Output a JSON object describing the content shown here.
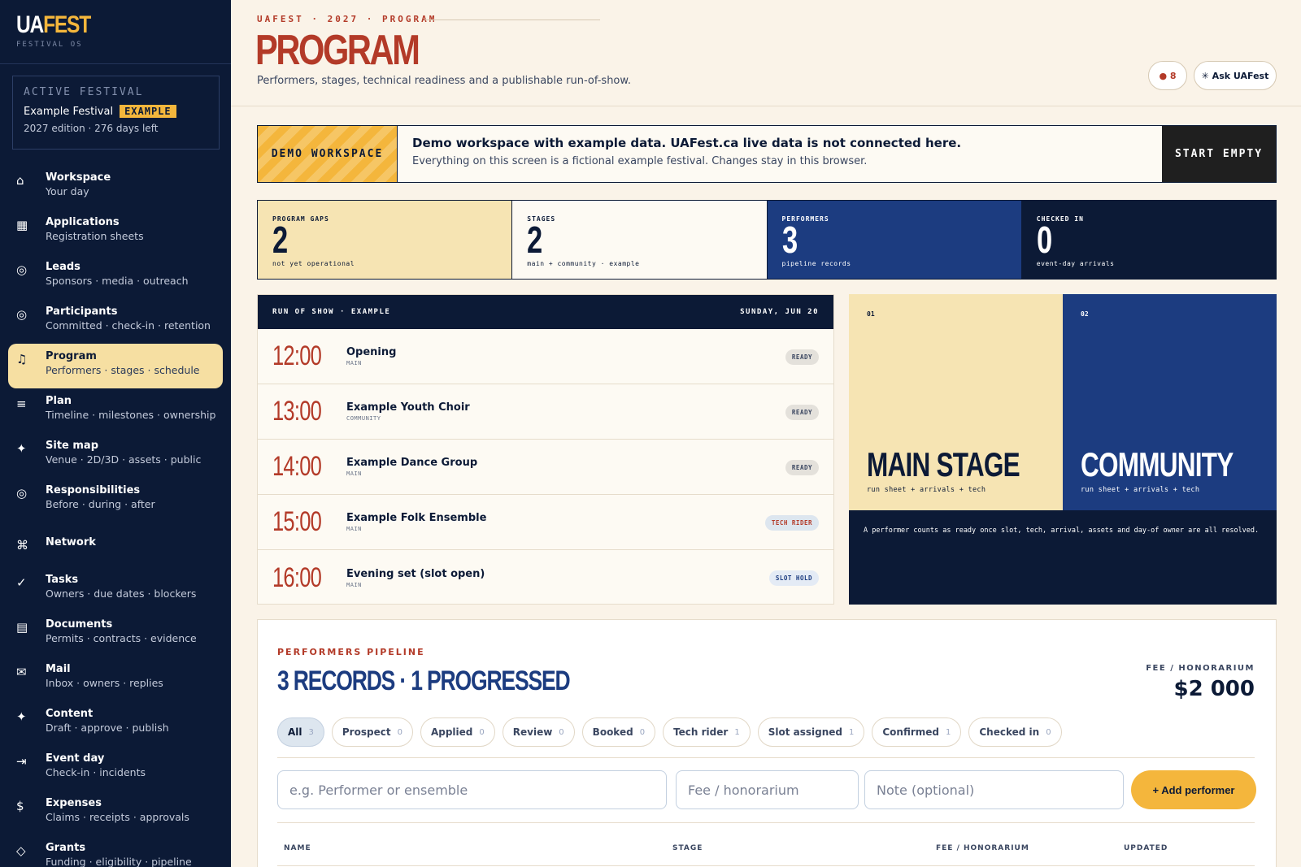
{
  "brand": {
    "logo_a": "UA",
    "logo_b": "FEST",
    "sub": "FESTIVAL OS"
  },
  "active_festival": {
    "label": "ACTIVE FESTIVAL",
    "name": "Example Festival",
    "badge": "EXAMPLE",
    "meta": "2027 edition · 276 days left"
  },
  "nav": [
    {
      "icon": "⌂",
      "title": "Workspace",
      "sub": "Your day"
    },
    {
      "icon": "▦",
      "title": "Applications",
      "sub": "Registration sheets"
    },
    {
      "icon": "◎",
      "title": "Leads",
      "sub": "Sponsors · media · outreach"
    },
    {
      "icon": "◎",
      "title": "Participants",
      "sub": "Committed · check-in · retention"
    },
    {
      "icon": "♫",
      "title": "Program",
      "sub": "Performers · stages · schedule"
    },
    {
      "icon": "≡",
      "title": "Plan",
      "sub": "Timeline · milestones · ownership"
    },
    {
      "icon": "✦",
      "title": "Site map",
      "sub": "Venue · 2D/3D · assets · public"
    },
    {
      "icon": "◎",
      "title": "Responsibilities",
      "sub": "Before · during · after"
    },
    {
      "icon": "⌘",
      "title": "Network",
      "sub": ""
    },
    {
      "icon": "✓",
      "title": "Tasks",
      "sub": "Owners · due dates · blockers"
    },
    {
      "icon": "▤",
      "title": "Documents",
      "sub": "Permits · contracts · evidence"
    },
    {
      "icon": "✉",
      "title": "Mail",
      "sub": "Inbox · owners · replies"
    },
    {
      "icon": "✦",
      "title": "Content",
      "sub": "Draft · approve · publish"
    },
    {
      "icon": "⇥",
      "title": "Event day",
      "sub": "Check-in · incidents"
    },
    {
      "icon": "$",
      "title": "Expenses",
      "sub": "Claims · receipts · approvals"
    },
    {
      "icon": "◇",
      "title": "Grants",
      "sub": "Funding · eligibility · pipeline"
    }
  ],
  "header": {
    "crumb": "UAFEST · 2027 · PROGRAM",
    "title": "PROGRAM",
    "subtitle": "Performers, stages, technical readiness and a publishable run-of-show.",
    "notif": "● 8",
    "ask": "✳ Ask UAFest"
  },
  "banner": {
    "tag": "DEMO WORKSPACE",
    "heading": "Demo workspace with example data. UAFest.ca live data is not connected here.",
    "text": "Everything on this screen is a fictional example festival. Changes stay in this browser.",
    "button": "START EMPTY"
  },
  "stats": [
    {
      "label": "PROGRAM GAPS",
      "value": "2",
      "sub": "not yet operational"
    },
    {
      "label": "STAGES",
      "value": "2",
      "sub": "main + community · example"
    },
    {
      "label": "PERFORMERS",
      "value": "3",
      "sub": "pipeline records"
    },
    {
      "label": "CHECKED IN",
      "value": "0",
      "sub": "event-day arrivals"
    }
  ],
  "run_of_show": {
    "title": "RUN OF SHOW · EXAMPLE",
    "date": "SUNDAY, JUN 20",
    "rows": [
      {
        "time": "12:00",
        "name": "Opening",
        "stage": "MAIN",
        "badge": "READY"
      },
      {
        "time": "13:00",
        "name": "Example Youth Choir",
        "stage": "COMMUNITY",
        "badge": "READY"
      },
      {
        "time": "14:00",
        "name": "Example Dance Group",
        "stage": "MAIN",
        "badge": "READY"
      },
      {
        "time": "15:00",
        "name": "Example Folk Ensemble",
        "stage": "MAIN",
        "badge": "TECH RIDER"
      },
      {
        "time": "16:00",
        "name": "Evening set (slot open)",
        "stage": "MAIN",
        "badge": "SLOT HOLD"
      }
    ]
  },
  "stages": [
    {
      "num": "01",
      "name": "MAIN STAGE",
      "sub": "run sheet + arrivals + tech"
    },
    {
      "num": "02",
      "name": "COMMUNITY",
      "sub": "run sheet + arrivals + tech"
    }
  ],
  "stage_note": "A performer counts as ready once slot, tech, arrival, assets and day-of owner are all resolved.",
  "pipeline": {
    "label": "PERFORMERS PIPELINE",
    "title": "3 RECORDS · 1 PROGRESSED",
    "fee_label": "FEE / HONORARIUM",
    "fee_value": "$2 000",
    "filters": [
      {
        "label": "All",
        "count": "3"
      },
      {
        "label": "Prospect",
        "count": "0"
      },
      {
        "label": "Applied",
        "count": "0"
      },
      {
        "label": "Review",
        "count": "0"
      },
      {
        "label": "Booked",
        "count": "0"
      },
      {
        "label": "Tech rider",
        "count": "1"
      },
      {
        "label": "Slot assigned",
        "count": "1"
      },
      {
        "label": "Confirmed",
        "count": "1"
      },
      {
        "label": "Checked in",
        "count": "0"
      }
    ],
    "placeholders": {
      "name": "e.g. Performer or ensemble",
      "fee": "Fee / honorarium",
      "note": "Note (optional)"
    },
    "add_button": "+ Add performer",
    "columns": [
      "NAME",
      "STAGE",
      "FEE / HONORARIUM",
      "UPDATED"
    ]
  }
}
